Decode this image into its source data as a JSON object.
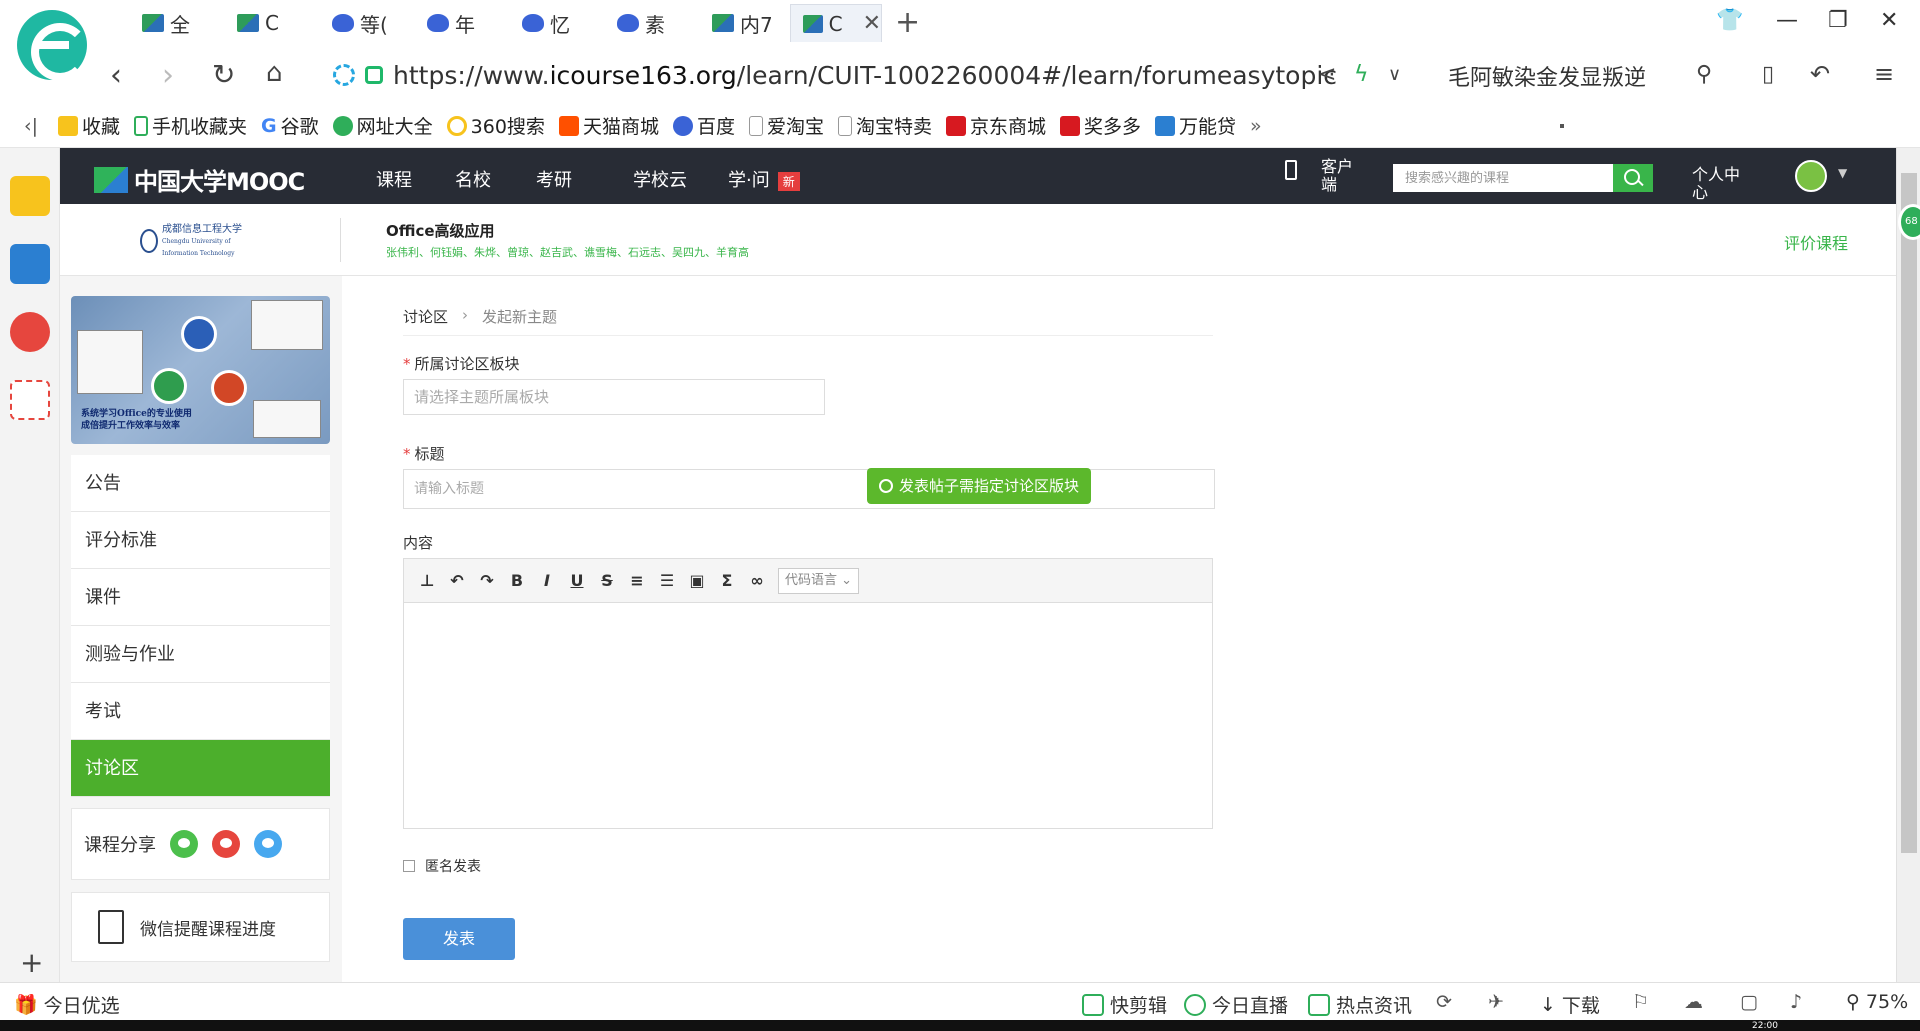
{
  "browser": {
    "tabs": [
      {
        "label": "全",
        "icon": "book"
      },
      {
        "label": "C",
        "icon": "book"
      },
      {
        "label": "等(",
        "icon": "paw"
      },
      {
        "label": "年",
        "icon": "paw"
      },
      {
        "label": "忆",
        "icon": "paw"
      },
      {
        "label": "素",
        "icon": "paw"
      },
      {
        "label": "内7",
        "icon": "book"
      },
      {
        "label": "C",
        "icon": "book",
        "active": true
      }
    ],
    "url_prefix": "https://www.",
    "url_domain": "icourse163.org",
    "url_path": "/learn/CUIT-1002260004#/learn/forumeasytopic",
    "search_hint": "毛阿敏染金发显叛逆",
    "bookmarks": [
      "收藏",
      "手机收藏夹",
      "谷歌",
      "网址大全",
      "360搜索",
      "天猫商城",
      "百度",
      "爱淘宝",
      "淘宝特卖",
      "京东商城",
      "奖多多",
      "万能贷"
    ],
    "bookmark_more": "»"
  },
  "site": {
    "logo": "中国大学MOOC",
    "nav": [
      "课程",
      "名校",
      "考研",
      "学校云",
      "学·问"
    ],
    "new_badge": "新",
    "client": "客户端",
    "search_placeholder": "搜索感兴趣的课程",
    "personal": "个人中心"
  },
  "course": {
    "school_name": "成都信息工程大学",
    "school_en": "Chengdu University of Information Technology",
    "title": "Office高级应用",
    "teachers": "张伟利、何钰娟、朱烨、曾琼、赵吉武、谯雪梅、石远志、吴四九、羊育高",
    "rate": "评价课程",
    "cover_line1": "系统学习Office的专业使用",
    "cover_line2": "成倍提升工作效率与效率"
  },
  "menu": [
    {
      "label": "公告",
      "active": false
    },
    {
      "label": "评分标准",
      "active": false
    },
    {
      "label": "课件",
      "active": false
    },
    {
      "label": "测验与作业",
      "active": false
    },
    {
      "label": "考试",
      "active": false
    },
    {
      "label": "讨论区",
      "active": true
    }
  ],
  "share_label": "课程分享",
  "wechat_remind": "微信提醒课程进度",
  "form": {
    "crumb_root": "讨论区",
    "crumb_current": "发起新主题",
    "section_label": "所属讨论区板块",
    "section_placeholder": "请选择主题所属板块",
    "title_label": "标题",
    "title_placeholder": "请输入标题",
    "tooltip": "发表帖子需指定讨论区版块",
    "content_label": "内容",
    "code_lang": "代码语言",
    "anonymous": "匿名发表",
    "submit": "发表"
  },
  "statusbar": {
    "left": "今日优选",
    "items": [
      "快剪辑",
      "今日直播",
      "热点资讯",
      "下载"
    ],
    "zoom": "75%",
    "clock": "22:00"
  },
  "side_badge": "68"
}
